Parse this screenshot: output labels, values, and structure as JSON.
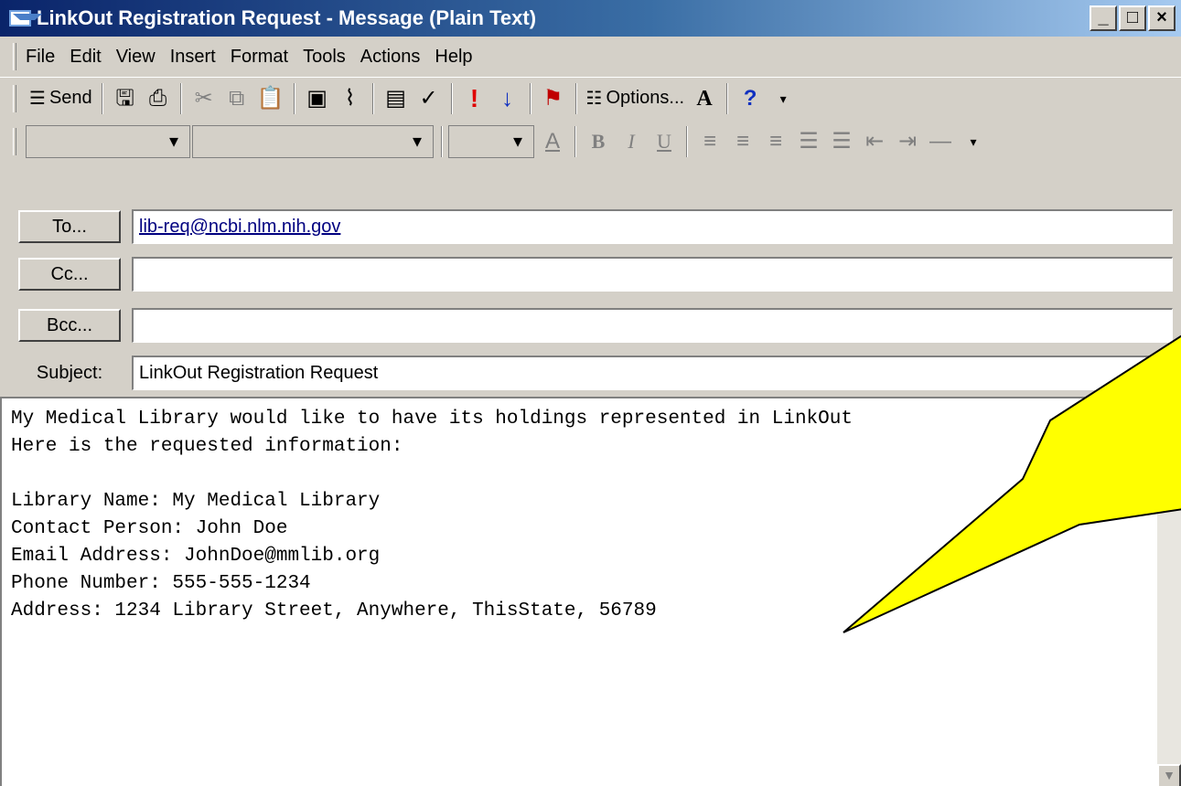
{
  "window": {
    "title": "LinkOut Registration Request - Message (Plain Text)",
    "min_glyph": "_",
    "max_glyph": "□",
    "close_glyph": "×"
  },
  "menu": [
    "File",
    "Edit",
    "View",
    "Insert",
    "Format",
    "Tools",
    "Actions",
    "Help"
  ],
  "toolbar": {
    "send_label": "Send",
    "options_label": "Options...",
    "icons": [
      "save-icon",
      "print-icon",
      "cut-icon",
      "copy-icon",
      "paste-icon",
      "insert-file-icon",
      "attach-icon",
      "address-book-icon",
      "check-names-icon",
      "importance-high-icon",
      "importance-low-icon",
      "flag-icon",
      "options-icon",
      "font-size-icon",
      "help-icon"
    ]
  },
  "format": {
    "bold": "B",
    "italic": "I",
    "underline": "U"
  },
  "fields": {
    "to_label": "To...",
    "to_value": "lib-req@ncbi.nlm.nih.gov",
    "cc_label": "Cc...",
    "cc_value": "",
    "bcc_label": "Bcc...",
    "bcc_value": "",
    "subject_label": "Subject:",
    "subject_value": "LinkOut Registration Request"
  },
  "body_text": "My Medical Library would like to have its holdings represented in LinkOut\nHere is the requested information:\n\nLibrary Name: My Medical Library\nContact Person: John Doe\nEmail Address: JohnDoe@mmlib.org\nPhone Number: 555-555-1234\nAddress: 1234 Library Street, Anywhere, ThisState, 56789",
  "colors": {
    "titlebar_start": "#0a246a",
    "titlebar_end": "#a6caf0",
    "chrome": "#d4d0c8",
    "callout_fill": "#ffff00"
  }
}
